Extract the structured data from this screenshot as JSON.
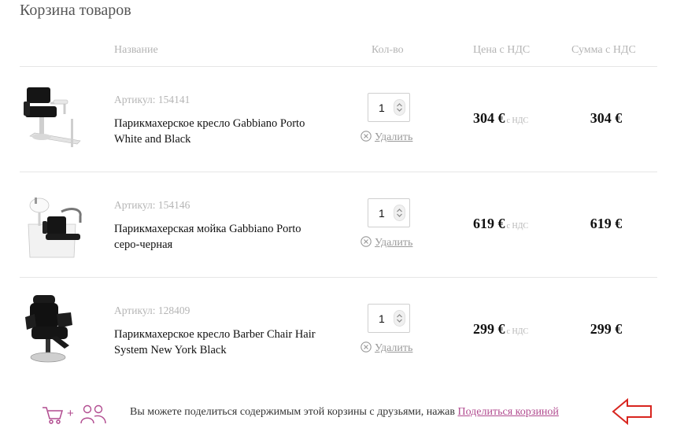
{
  "page": {
    "title": "Корзина товаров"
  },
  "table": {
    "headers": {
      "name": "Название",
      "qty": "Кол-во",
      "price": "Цена с НДС",
      "total": "Сумма с НДС"
    }
  },
  "items": [
    {
      "sku": "Артикул: 154141",
      "name": "Парикмахерское кресло Gabbiano Porto White and Black",
      "qty": "1",
      "delete_label": "Удалить",
      "price": "304 €",
      "vat_note": "с НДС",
      "total": "304 €",
      "image": "salon-chair-white-black"
    },
    {
      "sku": "Артикул: 154146",
      "name": "Парикмахерская мойка Gabbiano Porto серо-черная",
      "qty": "1",
      "delete_label": "Удалить",
      "price": "619 €",
      "vat_note": "с НДС",
      "total": "619 €",
      "image": "hair-wash-unit"
    },
    {
      "sku": "Артикул: 128409",
      "name": "Парикмахерское кресло Barber Chair Hair System New York Black",
      "qty": "1",
      "delete_label": "Удалить",
      "price": "299 €",
      "vat_note": "с НДС",
      "total": "299 €",
      "image": "barber-chair-black"
    }
  ],
  "share": {
    "text": "Вы можете поделиться содержимым этой корзины с друзьями, нажав",
    "link_label": "Поделиться корзиной",
    "plus": "+",
    "accent_color": "#b14b8f",
    "arrow_color": "#d8251f"
  }
}
